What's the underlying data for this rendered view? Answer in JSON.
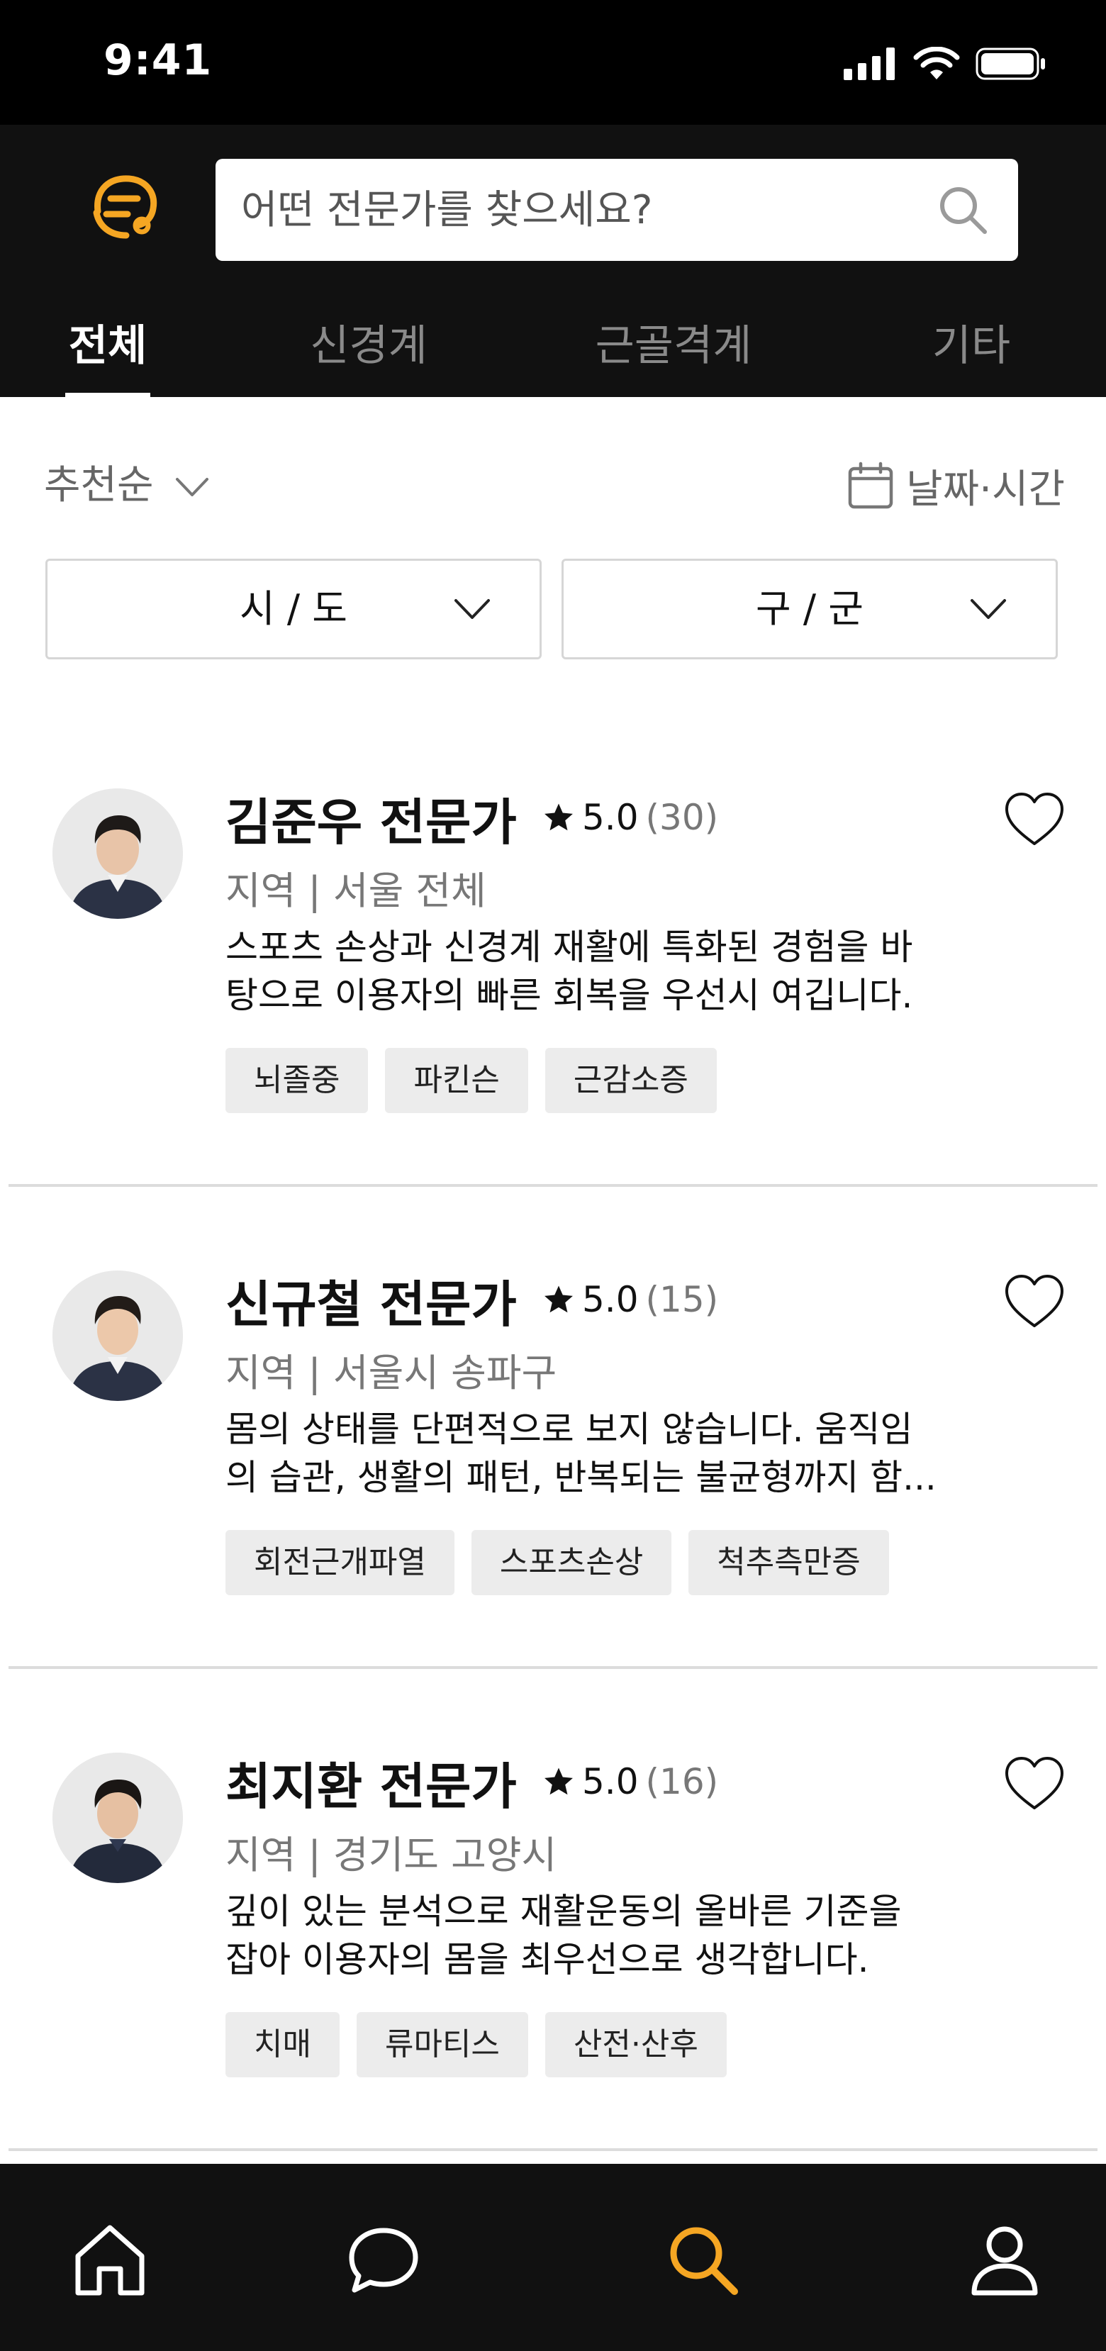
{
  "status_bar": {
    "time": "9:41"
  },
  "header": {
    "search": {
      "placeholder": "어떤 전문가를 찾으세요?"
    },
    "tabs": [
      {
        "label": "전체",
        "active": true
      },
      {
        "label": "신경계",
        "active": false
      },
      {
        "label": "근골격계",
        "active": false
      },
      {
        "label": "기타",
        "active": false
      }
    ],
    "accent_color": "#F5A623"
  },
  "filters": {
    "sort_label": "추천순",
    "date_label": "날짜·시간",
    "city_select": "시 / 도",
    "district_select": "구 / 군"
  },
  "experts": [
    {
      "name": "김준우 전문가",
      "rating": "5.0",
      "review_count": "(30)",
      "region": "지역 | 서울 전체",
      "description_lines": [
        "스포츠 손상과 신경계 재활에 특화된 경험을 바",
        "탕으로 이용자의 빠른 회복을 우선시 여깁니다."
      ],
      "tags": [
        "뇌졸중",
        "파킨슨",
        "근감소증"
      ]
    },
    {
      "name": "신규철 전문가",
      "rating": "5.0",
      "review_count": "(15)",
      "region": "지역 | 서울시 송파구",
      "description_lines": [
        "몸의 상태를 단편적으로 보지 않습니다. 움직임",
        "의 습관, 생활의 패턴, 반복되는 불균형까지 함..."
      ],
      "tags": [
        "회전근개파열",
        "스포츠손상",
        "척추측만증"
      ]
    },
    {
      "name": "최지환 전문가",
      "rating": "5.0",
      "review_count": "(16)",
      "region": "지역 | 경기도 고양시",
      "description_lines": [
        "깊이 있는 분석으로 재활운동의 올바른 기준을",
        "잡아 이용자의 몸을 최우선으로 생각합니다."
      ],
      "tags": [
        "치매",
        "류마티스",
        "산전·산후"
      ]
    }
  ],
  "bottom_nav": {
    "items": [
      {
        "icon": "home-icon",
        "active": false
      },
      {
        "icon": "chat-icon",
        "active": false
      },
      {
        "icon": "search-icon",
        "active": true
      },
      {
        "icon": "profile-icon",
        "active": false
      }
    ]
  }
}
